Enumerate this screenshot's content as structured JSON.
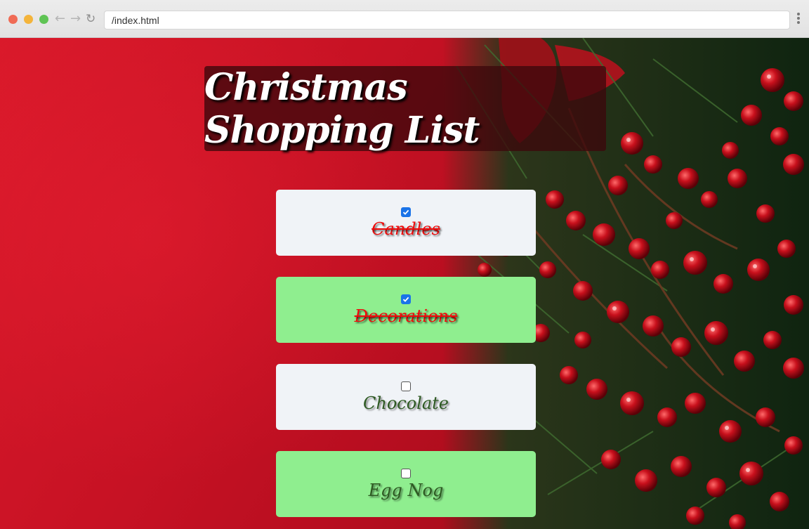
{
  "browser": {
    "url": "/index.html"
  },
  "page": {
    "title": "Christmas Shopping List",
    "items": [
      {
        "label": "Candles",
        "checked": true
      },
      {
        "label": "Decorations",
        "checked": true
      },
      {
        "label": "Chocolate",
        "checked": false
      },
      {
        "label": "Egg Nog",
        "checked": false
      }
    ]
  },
  "colors": {
    "background_red": "#c71224",
    "title_box": "#3c080c",
    "item_white": "#f0f3f7",
    "item_green": "#8fee8f",
    "done_text": "#ef0b0b",
    "todo_text": "#2e5a23",
    "checkbox_blue": "#1a73e8"
  }
}
